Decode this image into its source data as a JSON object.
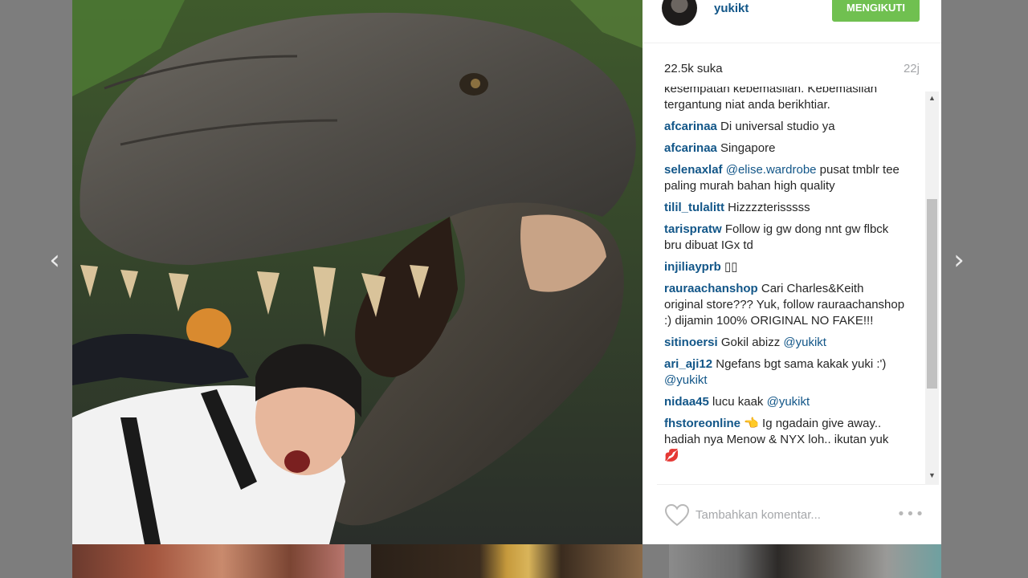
{
  "post": {
    "username": "yukikt",
    "follow_label": "MENGIKUTI",
    "likes": "22.5k suka",
    "time": "22j"
  },
  "comments": [
    {
      "author": "",
      "parts": [
        {
          "t": "kesempatan kebemasilan. Kebemasilan tergantung niat anda berikhtiar."
        }
      ]
    },
    {
      "author": "afcarinaa",
      "parts": [
        {
          "t": " Di universal studio ya"
        }
      ]
    },
    {
      "author": "afcarinaa",
      "parts": [
        {
          "t": " Singapore"
        }
      ]
    },
    {
      "author": "selenaxlaf",
      "parts": [
        {
          "t": " "
        },
        {
          "t": "@elise.wardrobe",
          "m": true
        },
        {
          "t": " pusat tmblr tee paling murah bahan high quality"
        }
      ]
    },
    {
      "author": "tilil_tulalitt",
      "parts": [
        {
          "t": " Hizzzzterisssss"
        }
      ]
    },
    {
      "author": "tarispratw",
      "parts": [
        {
          "t": " Follow ig gw dong nnt gw flbck bru dibuat IGx td"
        }
      ]
    },
    {
      "author": "injiliayprb",
      "parts": [
        {
          "t": " ▯▯"
        }
      ]
    },
    {
      "author": "rauraachanshop",
      "parts": [
        {
          "t": " Cari Charles&Keith original store??? Yuk, follow rauraachanshop :) dijamin 100% ORIGINAL NO FAKE!!!"
        }
      ]
    },
    {
      "author": "sitinoersi",
      "parts": [
        {
          "t": " Gokil abizz "
        },
        {
          "t": "@yukikt",
          "m": true
        }
      ]
    },
    {
      "author": "ari_aji12",
      "parts": [
        {
          "t": " Ngefans bgt sama kakak yuki :') "
        },
        {
          "t": "@yukikt",
          "m": true
        }
      ]
    },
    {
      "author": "nidaa45",
      "parts": [
        {
          "t": " lucu kaak "
        },
        {
          "t": "@yukikt",
          "m": true
        }
      ]
    },
    {
      "author": "fhstoreonline",
      "parts": [
        {
          "t": " 👈 Ig ngadain give away.. hadiah nya Menow & NYX loh.. ikutan yuk 💋"
        }
      ]
    }
  ],
  "footer": {
    "comment_placeholder": "Tambahkan komentar...",
    "more_label": "•••"
  },
  "nav": {
    "prev_label": "‹",
    "next_label": "›"
  },
  "icons": {
    "prev": "chevron-left-icon",
    "next": "chevron-right-icon",
    "like": "heart-icon",
    "more": "more-options-icon"
  },
  "colors": {
    "link": "#125688",
    "follow_button": "#70c050",
    "muted": "#a5a7aa",
    "backdrop": "#7d7d7d"
  }
}
